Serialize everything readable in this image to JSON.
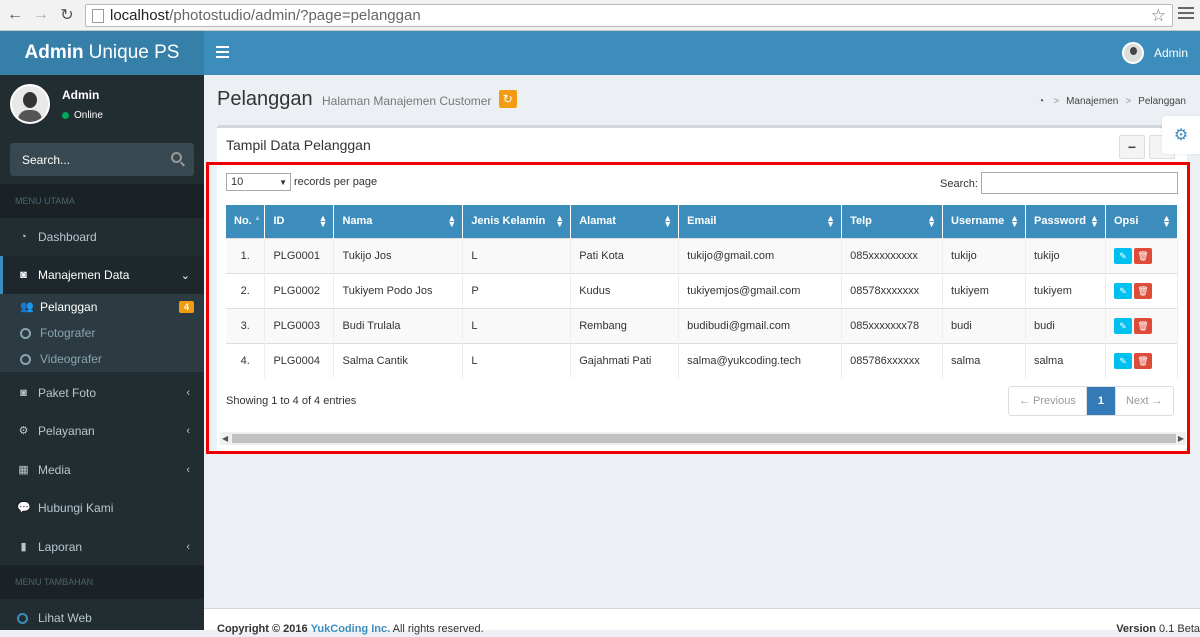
{
  "browser": {
    "url_host": "localhost",
    "url_path": "/photostudio/admin/?page=pelanggan"
  },
  "header": {
    "logo_bold": "Admin",
    "logo_rest": "Unique PS",
    "user_name": "Admin"
  },
  "sidebar": {
    "user_name": "Admin",
    "user_status": "Online",
    "search_placeholder": "Search...",
    "section_main": "MENU UTAMA",
    "section_extra": "MENU TAMBAHAN",
    "items": {
      "dashboard": "Dashboard",
      "manajemen": "Manajemen Data",
      "pelanggan": "Pelanggan",
      "pelanggan_badge": "4",
      "fotografer": "Fotografer",
      "videografer": "Videografer",
      "paket": "Paket Foto",
      "pelayanan": "Pelayanan",
      "media": "Media",
      "hubungi": "Hubungi Kami",
      "laporan": "Laporan",
      "lihat_web": "Lihat Web"
    }
  },
  "content": {
    "title": "Pelanggan",
    "subtitle": "Halaman Manajemen Customer",
    "breadcrumb": [
      "Manajemen",
      "Pelanggan"
    ],
    "box_title": "Tampil Data Pelanggan",
    "collapse_label": "−",
    "length_value": "10",
    "length_label": "records per page",
    "search_label": "Search:",
    "info": "Showing 1 to 4 of 4 entries",
    "prev": "← Previous",
    "page": "1",
    "next": "Next →"
  },
  "table": {
    "headers": [
      "No.",
      "ID",
      "Nama",
      "Jenis Kelamin",
      "Alamat",
      "Email",
      "Telp",
      "Username",
      "Password",
      "Opsi"
    ],
    "rows": [
      [
        "1.",
        "PLG0001",
        "Tukijo Jos",
        "L",
        "Pati Kota",
        "tukijo@gmail.com",
        "085xxxxxxxxx",
        "tukijo",
        "tukijo"
      ],
      [
        "2.",
        "PLG0002",
        "Tukiyem Podo Jos",
        "P",
        "Kudus",
        "tukiyemjos@gmail.com",
        "08578xxxxxxx",
        "tukiyem",
        "tukiyem"
      ],
      [
        "3.",
        "PLG0003",
        "Budi Trulala",
        "L",
        "Rembang",
        "budibudi@gmail.com",
        "085xxxxxxx78",
        "budi",
        "budi"
      ],
      [
        "4.",
        "PLG0004",
        "Salma Cantik",
        "L",
        "Gajahmati Pati",
        "salma@yukcoding.tech",
        "085786xxxxxx",
        "salma",
        "salma"
      ]
    ]
  },
  "footer": {
    "copyright": "Copyright © 2016",
    "company": "YukCoding Inc.",
    "rights": "All rights reserved.",
    "version_label": "Version",
    "version": "0.1 Beta"
  }
}
